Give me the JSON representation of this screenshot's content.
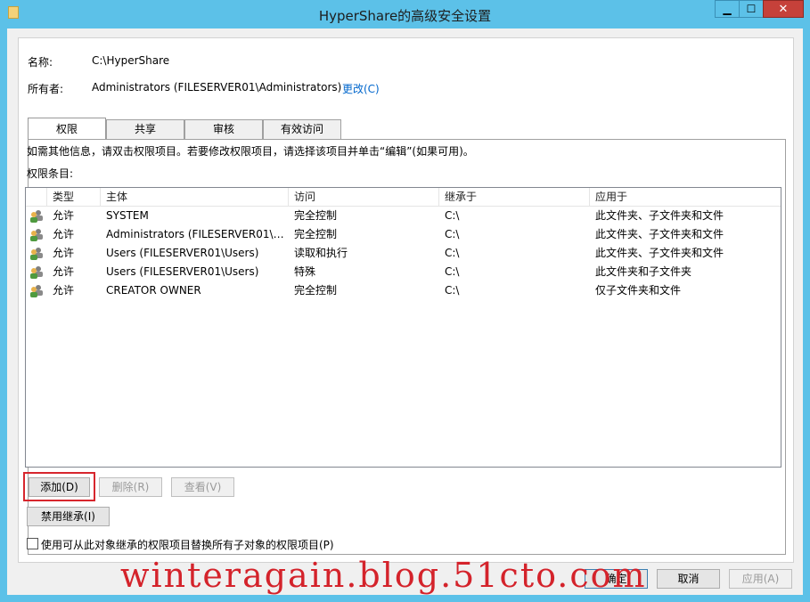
{
  "window": {
    "title": "HyperShare的高级安全设置",
    "minimize_glyph": "▁",
    "maximize_glyph": "☐",
    "close_glyph": "✕"
  },
  "info": {
    "name_label": "名称:",
    "name_value": "C:\\HyperShare",
    "owner_label": "所有者:",
    "owner_value": "Administrators (FILESERVER01\\Administrators)",
    "change_link": "更改(C)"
  },
  "tabs": [
    {
      "label": "权限",
      "active": true
    },
    {
      "label": "共享",
      "active": false
    },
    {
      "label": "审核",
      "active": false
    },
    {
      "label": "有效访问",
      "active": false
    }
  ],
  "permissions": {
    "help_text": "如需其他信息，请双击权限项目。若要修改权限项目，请选择该项目并单击“编辑”(如果可用)。",
    "entries_label": "权限条目:",
    "columns": [
      "类型",
      "主体",
      "访问",
      "继承于",
      "应用于"
    ],
    "rows": [
      {
        "icon": "user-group-icon",
        "type": "允许",
        "principal": "SYSTEM",
        "access": "完全控制",
        "inherited_from": "C:\\",
        "applies_to": "此文件夹、子文件夹和文件"
      },
      {
        "icon": "user-group-icon",
        "type": "允许",
        "principal": "Administrators (FILESERVER01\\A...",
        "access": "完全控制",
        "inherited_from": "C:\\",
        "applies_to": "此文件夹、子文件夹和文件"
      },
      {
        "icon": "user-group-icon",
        "type": "允许",
        "principal": "Users (FILESERVER01\\Users)",
        "access": "读取和执行",
        "inherited_from": "C:\\",
        "applies_to": "此文件夹、子文件夹和文件"
      },
      {
        "icon": "user-group-icon",
        "type": "允许",
        "principal": "Users (FILESERVER01\\Users)",
        "access": "特殊",
        "inherited_from": "C:\\",
        "applies_to": "此文件夹和子文件夹"
      },
      {
        "icon": "user-group-icon",
        "type": "允许",
        "principal": "CREATOR OWNER",
        "access": "完全控制",
        "inherited_from": "C:\\",
        "applies_to": "仅子文件夹和文件"
      }
    ]
  },
  "buttons": {
    "add": "添加(D)",
    "remove": "删除(R)",
    "view": "查看(V)",
    "disable_inheritance": "禁用继承(I)",
    "ok": "确定",
    "cancel": "取消",
    "apply": "应用(A)"
  },
  "replace_checkbox_label": "使用可从此对象继承的权限项目替换所有子对象的权限项目(P)",
  "watermark": "winteragain.blog.51cto.com",
  "colors": {
    "title_bar": "#5cc1e8",
    "close_button": "#c6413a",
    "highlight": "#d7262d",
    "link": "#0066cc"
  }
}
